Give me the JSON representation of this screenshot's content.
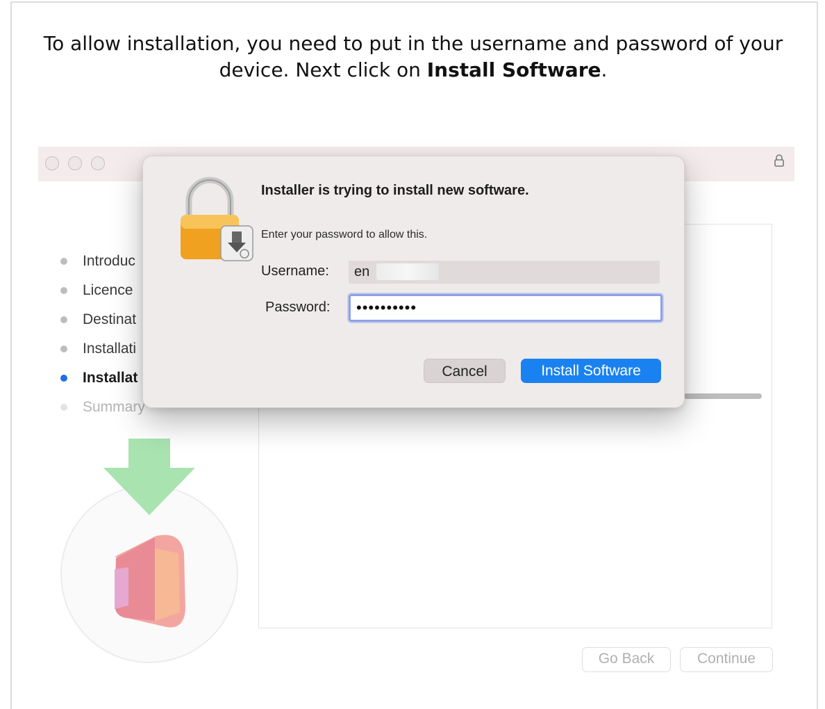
{
  "instruction": {
    "text_before": "To allow installation, you need to put in the username and password of your device. Next click on ",
    "bold": "Install Software",
    "text_after": "."
  },
  "installer": {
    "steps": [
      {
        "label": "Introduc",
        "state": "done"
      },
      {
        "label": "Licence",
        "state": "done"
      },
      {
        "label": "Destinat",
        "state": "done"
      },
      {
        "label": "Installati",
        "state": "done"
      },
      {
        "label": "Installat",
        "state": "active"
      },
      {
        "label": "Summary",
        "state": "pending"
      }
    ],
    "go_back": "Go Back",
    "continue": "Continue"
  },
  "dialog": {
    "title": "Installer is trying to install new software.",
    "subtitle": "Enter your password to allow this.",
    "username_label": "Username:",
    "username_value": "en",
    "password_label": "Password:",
    "password_value": "••••••••••",
    "cancel": "Cancel",
    "install": "Install Software"
  },
  "colors": {
    "accent": "#1a82f0",
    "active_step": "#1f6fe8"
  }
}
